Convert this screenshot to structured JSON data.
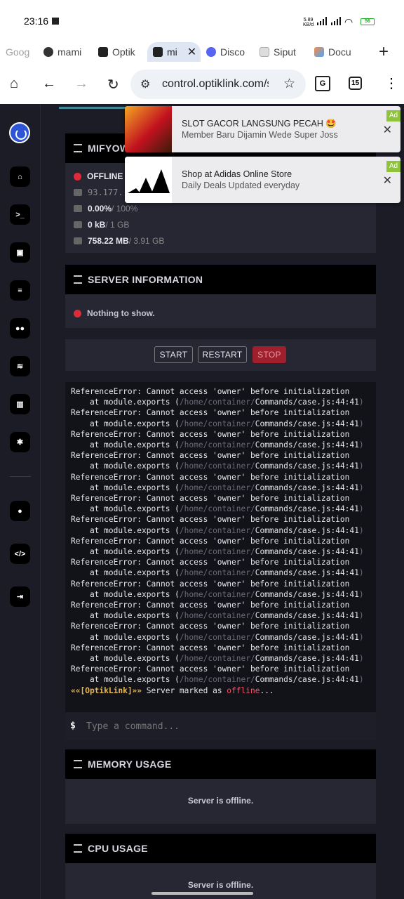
{
  "status": {
    "time": "23:16",
    "net_speed": "5.89\nKB/d",
    "battery": "56"
  },
  "tabs": [
    {
      "label": "Goog",
      "color": "#cccccc"
    },
    {
      "label": "mami",
      "color": "#333333"
    },
    {
      "label": "Optik",
      "color": "#222222"
    },
    {
      "label": "mi",
      "color": "#222222",
      "active": true
    },
    {
      "label": "Disco",
      "color": "#5865f2"
    },
    {
      "label": "Siput",
      "color": "#dddddd"
    },
    {
      "label": "Docu",
      "color": "#ff8844"
    }
  ],
  "toolbar": {
    "url": "control.optiklink.com/s",
    "tab_count": "15"
  },
  "ads": [
    {
      "title": "SLOT GACOR LANGSUNG PECAH 🤩",
      "subtitle": "Member Baru Dijamin Wede Super Joss",
      "tag": "Ad"
    },
    {
      "title": "Shop at Adidas Online Store",
      "subtitle": "Daily Deals Updated everyday",
      "tag": "Ad"
    }
  ],
  "server_panel": {
    "title": "MIFYOW",
    "state": "OFFLINE",
    "ip": "93.177.",
    "cpu": "0.00%",
    "cpu_limit": " / 100%",
    "disk": "0 kB",
    "disk_limit": " / 1 GB",
    "memory": "758.22 MB",
    "memory_limit": " / 3.91 GB"
  },
  "server_info": {
    "title": "SERVER INFORMATION",
    "empty": "Nothing to show."
  },
  "controls": {
    "start": "START",
    "restart": "RESTART",
    "stop": "STOP"
  },
  "console": {
    "err": "ReferenceError: Cannot access 'owner' before initialization",
    "at": "    at module.exports (",
    "path": "/home/container/",
    "file": "Commands/case.js:44:41",
    "close": ")",
    "repeat": 14,
    "brand": "««[OptikLink]»»",
    "msg": " Server marked as ",
    "offline": "offline",
    "ellipsis": "..."
  },
  "command": {
    "prompt": "$",
    "placeholder": "Type a command..."
  },
  "memory_panel": {
    "title": "MEMORY USAGE",
    "msg": "Server is offline."
  },
  "cpu_panel": {
    "title": "CPU USAGE",
    "msg": "Server is offline."
  }
}
